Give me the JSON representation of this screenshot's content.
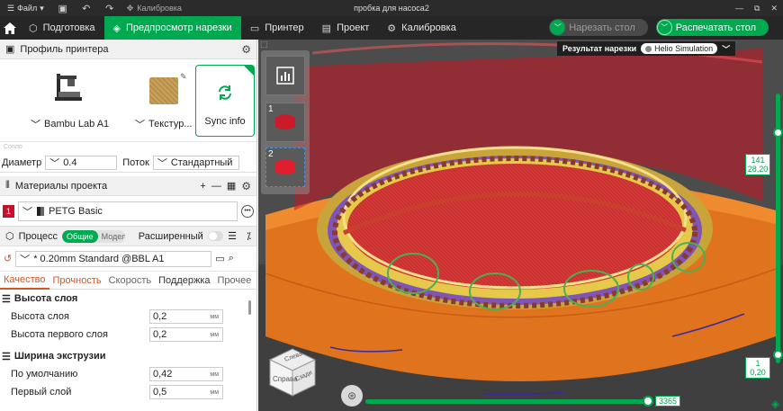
{
  "titlebar": {
    "file_menu": "Файл",
    "calibration": "Калибровка",
    "window_title": "пробка для насоса2",
    "icons": [
      "menu-icon",
      "save-icon",
      "undo-icon",
      "redo-icon",
      "calibration-icon",
      "minimize-icon",
      "restore-icon",
      "close-icon"
    ]
  },
  "toolbar": {
    "tabs": [
      {
        "label": "Подготовка",
        "icon": "cube-icon"
      },
      {
        "label": "Предпросмотр нарезки",
        "icon": "layers-icon"
      },
      {
        "label": "Принтер",
        "icon": "monitor-icon"
      },
      {
        "label": "Проект",
        "icon": "project-icon"
      },
      {
        "label": "Калибровка",
        "icon": "calibration-icon"
      }
    ],
    "active_tab": "Предпросмотр нарезки",
    "slice_button": "Нарезать стол",
    "print_button": "Распечатать стол",
    "accent": "#00a84f"
  },
  "printer_section": {
    "title": "Профиль принтера",
    "printer_name": "Bambu Lab A1",
    "plate_name": "Текстур...",
    "sync_label": "Sync info",
    "nozzle_caption": "Сопло",
    "diameter_label": "Диаметр",
    "diameter_value": "0.4",
    "flow_label": "Поток",
    "flow_value": "Стандартный"
  },
  "materials_section": {
    "title": "Материалы проекта",
    "items": [
      {
        "index": "1",
        "name": "PETG Basic",
        "color": "#c8102e"
      }
    ]
  },
  "process_section": {
    "title": "Процесс",
    "seg_on": "Общие",
    "seg_off": "Модели",
    "advanced_label": "Расширенный",
    "preset": "* 0.20mm Standard @BBL A1",
    "tabs": [
      "Качество",
      "Прочность",
      "Скорость",
      "Поддержка",
      "Прочее"
    ],
    "active_tab": "Качество",
    "groups": [
      {
        "title": "Высота слоя",
        "params": [
          {
            "name": "Высота слоя",
            "value": "0,2",
            "unit": "мм"
          },
          {
            "name": "Высота первого слоя",
            "value": "0,2",
            "unit": "мм"
          }
        ]
      },
      {
        "title": "Ширина экструзии",
        "params": [
          {
            "name": "По умолчанию",
            "value": "0,42",
            "unit": "мм"
          },
          {
            "name": "Первый слой",
            "value": "0,5",
            "unit": "мм"
          }
        ]
      }
    ]
  },
  "viewport": {
    "result_label": "Результат нарезки",
    "helio_label": "Helio Simulation",
    "plates": [
      {
        "num": "1"
      },
      {
        "num": "2"
      }
    ],
    "layer_top": "141",
    "layer_top_height": "28,20",
    "layer_bottom": "1",
    "layer_bottom_height": "0,20",
    "move_value": "3365",
    "cube_labels": [
      "Справа",
      "Сзади",
      "Слева"
    ]
  }
}
